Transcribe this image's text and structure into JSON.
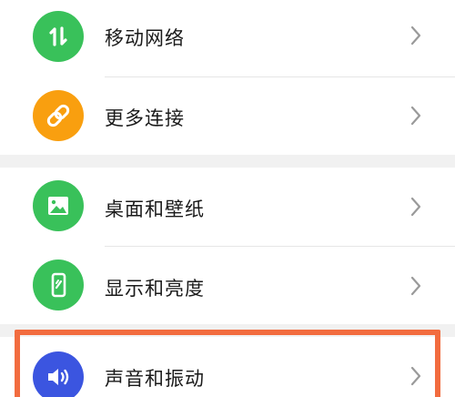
{
  "colors": {
    "green": "#39c15a",
    "orange": "#f99f0f",
    "blue": "#3b55e0",
    "highlight": "#f26c3f"
  },
  "settings": {
    "items": [
      {
        "label": "移动网络",
        "icon": "mobile-data-arrows-icon",
        "icon_color": "green"
      },
      {
        "label": "更多连接",
        "icon": "link-icon",
        "icon_color": "orange"
      },
      {
        "label": "桌面和壁纸",
        "icon": "image-icon",
        "icon_color": "green"
      },
      {
        "label": "显示和亮度",
        "icon": "phone-display-icon",
        "icon_color": "green"
      },
      {
        "label": "声音和振动",
        "icon": "speaker-icon",
        "icon_color": "blue"
      }
    ]
  }
}
